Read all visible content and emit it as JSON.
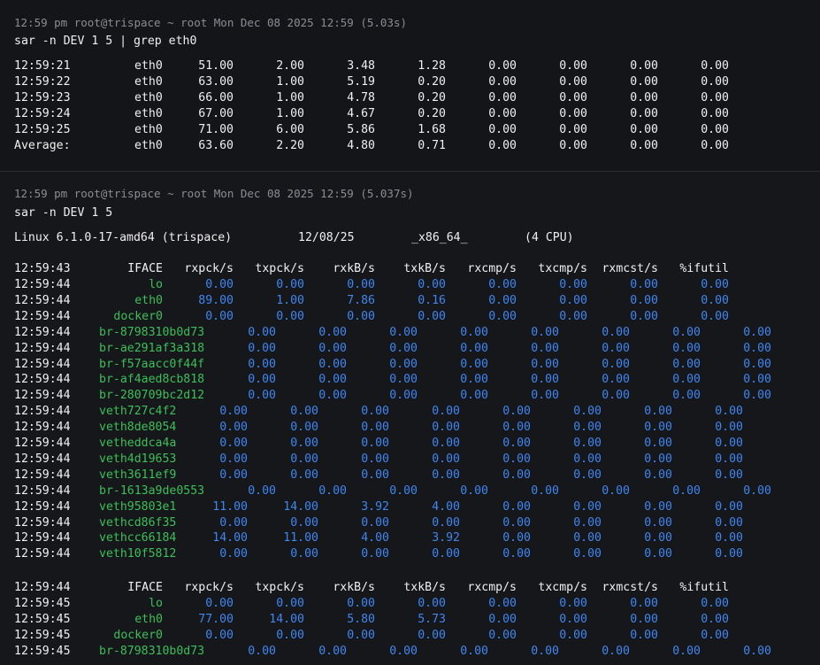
{
  "block1": {
    "header": "12:59 pm root@trispace ~ root Mon Dec 08 2025 12:59 (5.03s)",
    "command": "sar -n DEV 1 5 | grep eth0",
    "rows": [
      [
        "12:59:21",
        "eth0",
        "51.00",
        "2.00",
        "3.48",
        "1.28",
        "0.00",
        "0.00",
        "0.00",
        "0.00"
      ],
      [
        "12:59:22",
        "eth0",
        "63.00",
        "1.00",
        "5.19",
        "0.20",
        "0.00",
        "0.00",
        "0.00",
        "0.00"
      ],
      [
        "12:59:23",
        "eth0",
        "66.00",
        "1.00",
        "4.78",
        "0.20",
        "0.00",
        "0.00",
        "0.00",
        "0.00"
      ],
      [
        "12:59:24",
        "eth0",
        "67.00",
        "1.00",
        "4.67",
        "0.20",
        "0.00",
        "0.00",
        "0.00",
        "0.00"
      ],
      [
        "12:59:25",
        "eth0",
        "71.00",
        "6.00",
        "5.86",
        "1.68",
        "0.00",
        "0.00",
        "0.00",
        "0.00"
      ],
      [
        "Average:",
        "eth0",
        "63.60",
        "2.20",
        "4.80",
        "0.71",
        "0.00",
        "0.00",
        "0.00",
        "0.00"
      ]
    ]
  },
  "block2": {
    "header": "12:59 pm root@trispace ~ root Mon Dec 08 2025 12:59 (5.037s)",
    "command": "sar -n DEV 1 5",
    "sysinfo": {
      "kernel": "Linux 6.1.0-17-amd64 (trispace)",
      "date": "12/08/25",
      "arch": "_x86_64_",
      "cpu": "(4 CPU)"
    },
    "columns": [
      "IFACE",
      "rxpck/s",
      "txpck/s",
      "rxkB/s",
      "txkB/s",
      "rxcmp/s",
      "txcmp/s",
      "rxmcst/s",
      "%ifutil"
    ],
    "section1_time": "12:59:43",
    "section1_rows": [
      [
        "12:59:44",
        "lo",
        "0.00",
        "0.00",
        "0.00",
        "0.00",
        "0.00",
        "0.00",
        "0.00",
        "0.00"
      ],
      [
        "12:59:44",
        "eth0",
        "89.00",
        "1.00",
        "7.86",
        "0.16",
        "0.00",
        "0.00",
        "0.00",
        "0.00"
      ],
      [
        "12:59:44",
        "docker0",
        "0.00",
        "0.00",
        "0.00",
        "0.00",
        "0.00",
        "0.00",
        "0.00",
        "0.00"
      ],
      [
        "12:59:44",
        "br-8798310b0d73",
        "0.00",
        "0.00",
        "0.00",
        "0.00",
        "0.00",
        "0.00",
        "0.00",
        "0.00"
      ],
      [
        "12:59:44",
        "br-ae291af3a318",
        "0.00",
        "0.00",
        "0.00",
        "0.00",
        "0.00",
        "0.00",
        "0.00",
        "0.00"
      ],
      [
        "12:59:44",
        "br-f57aacc0f44f",
        "0.00",
        "0.00",
        "0.00",
        "0.00",
        "0.00",
        "0.00",
        "0.00",
        "0.00"
      ],
      [
        "12:59:44",
        "br-af4aed8cb818",
        "0.00",
        "0.00",
        "0.00",
        "0.00",
        "0.00",
        "0.00",
        "0.00",
        "0.00"
      ],
      [
        "12:59:44",
        "br-280709bc2d12",
        "0.00",
        "0.00",
        "0.00",
        "0.00",
        "0.00",
        "0.00",
        "0.00",
        "0.00"
      ],
      [
        "12:59:44",
        "veth727c4f2",
        "0.00",
        "0.00",
        "0.00",
        "0.00",
        "0.00",
        "0.00",
        "0.00",
        "0.00"
      ],
      [
        "12:59:44",
        "veth8de8054",
        "0.00",
        "0.00",
        "0.00",
        "0.00",
        "0.00",
        "0.00",
        "0.00",
        "0.00"
      ],
      [
        "12:59:44",
        "vetheddca4a",
        "0.00",
        "0.00",
        "0.00",
        "0.00",
        "0.00",
        "0.00",
        "0.00",
        "0.00"
      ],
      [
        "12:59:44",
        "veth4d19653",
        "0.00",
        "0.00",
        "0.00",
        "0.00",
        "0.00",
        "0.00",
        "0.00",
        "0.00"
      ],
      [
        "12:59:44",
        "veth3611ef9",
        "0.00",
        "0.00",
        "0.00",
        "0.00",
        "0.00",
        "0.00",
        "0.00",
        "0.00"
      ],
      [
        "12:59:44",
        "br-1613a9de0553",
        "0.00",
        "0.00",
        "0.00",
        "0.00",
        "0.00",
        "0.00",
        "0.00",
        "0.00"
      ],
      [
        "12:59:44",
        "veth95803e1",
        "11.00",
        "14.00",
        "3.92",
        "4.00",
        "0.00",
        "0.00",
        "0.00",
        "0.00"
      ],
      [
        "12:59:44",
        "vethcd86f35",
        "0.00",
        "0.00",
        "0.00",
        "0.00",
        "0.00",
        "0.00",
        "0.00",
        "0.00"
      ],
      [
        "12:59:44",
        "vethcc66184",
        "14.00",
        "11.00",
        "4.00",
        "3.92",
        "0.00",
        "0.00",
        "0.00",
        "0.00"
      ],
      [
        "12:59:44",
        "veth10f5812",
        "0.00",
        "0.00",
        "0.00",
        "0.00",
        "0.00",
        "0.00",
        "0.00",
        "0.00"
      ]
    ],
    "section2_time": "12:59:44",
    "section2_rows": [
      [
        "12:59:45",
        "lo",
        "0.00",
        "0.00",
        "0.00",
        "0.00",
        "0.00",
        "0.00",
        "0.00",
        "0.00"
      ],
      [
        "12:59:45",
        "eth0",
        "77.00",
        "14.00",
        "5.80",
        "5.73",
        "0.00",
        "0.00",
        "0.00",
        "0.00"
      ],
      [
        "12:59:45",
        "docker0",
        "0.00",
        "0.00",
        "0.00",
        "0.00",
        "0.00",
        "0.00",
        "0.00",
        "0.00"
      ],
      [
        "12:59:45",
        "br-8798310b0d73",
        "0.00",
        "0.00",
        "0.00",
        "0.00",
        "0.00",
        "0.00",
        "0.00",
        "0.00"
      ]
    ]
  },
  "colors": {
    "blue": "#3f86f0",
    "green": "#3cbf5a",
    "text": "#f0f0f0",
    "dim": "#8a8d93"
  }
}
